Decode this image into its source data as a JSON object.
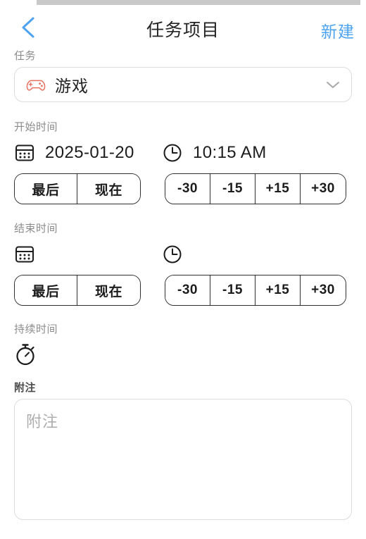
{
  "header": {
    "back_icon": "chevron-left-icon",
    "title": "任务项目",
    "action_label": "新建",
    "accent_color": "#4da3f0"
  },
  "task": {
    "label": "任务",
    "icon": "gamepad-icon",
    "icon_color": "#e8705f",
    "selected_value": "游戏",
    "dropdown_icon": "chevron-down-icon"
  },
  "start_time": {
    "label": "开始时间",
    "calendar_icon": "calendar-icon",
    "date_value": "2025-01-20",
    "clock_icon": "clock-icon",
    "time_value": "10:15 AM",
    "preset_buttons": [
      "最后",
      "现在"
    ],
    "adjust_buttons": [
      "-30",
      "-15",
      "+15",
      "+30"
    ]
  },
  "end_time": {
    "label": "结束时间",
    "calendar_icon": "calendar-icon",
    "date_value": "",
    "clock_icon": "clock-icon",
    "time_value": "",
    "preset_buttons": [
      "最后",
      "现在"
    ],
    "adjust_buttons": [
      "-30",
      "-15",
      "+15",
      "+30"
    ]
  },
  "duration": {
    "label": "持续时间",
    "icon": "stopwatch-icon",
    "value": ""
  },
  "notes": {
    "label": "附注",
    "placeholder": "附注",
    "value": ""
  }
}
